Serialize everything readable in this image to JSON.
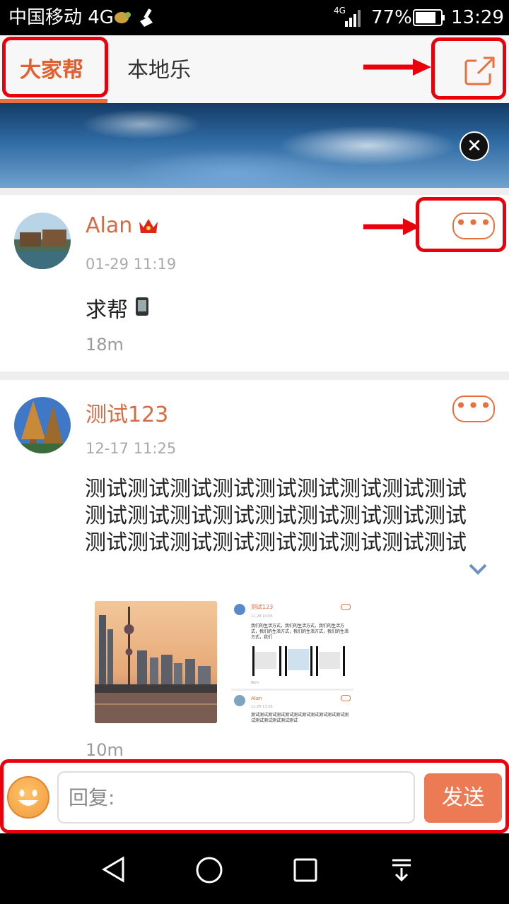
{
  "status_bar": {
    "carrier": "中国移动 4G",
    "network": "4G",
    "battery": "77%",
    "time": "13:29"
  },
  "header": {
    "tabs": [
      {
        "label": "大家帮",
        "active": true
      },
      {
        "label": "本地乐",
        "active": false
      }
    ],
    "share_icon": "share-external-icon",
    "accent_color": "#e8703f"
  },
  "banner": {
    "close_icon": "close-icon"
  },
  "posts": [
    {
      "username": "Alan",
      "badge_icon": "crown-icon",
      "timestamp": "01-29 11:19",
      "text": "求帮",
      "distance": "18m",
      "more_icon": "more-dots-icon"
    },
    {
      "username": "测试123",
      "timestamp": "12-17 11:25",
      "text_lines": [
        "测试测试测试测试测试测试测试测试测试",
        "测试测试测试测试测试测试测试测试测试",
        "测试测试测试测试测试测试测试测试测试"
      ],
      "distance": "10m",
      "more_icon": "more-dots-icon",
      "expand_icon": "chevron-down-icon",
      "thumbnail_screenshot": {
        "username1": "测试123",
        "time1": "11-28 10:06",
        "text1": "我们的生活方式，我们的生活方式，我们的生活方式，我们的生活方式，我们的生活方式，我们的生活方式，我们",
        "distance1": "0km",
        "username2": "Alan",
        "time2": "11-28 13:36",
        "text2": "测试测试测试测试测试测试测试测试测试测试测试测试测试测试测试测试测试"
      }
    }
  ],
  "reply_bar": {
    "placeholder": "回复:",
    "send_label": "发送",
    "emoji_icon": "emoji-smile-icon"
  },
  "nav_bar": {
    "icons": [
      "back-icon",
      "home-icon",
      "recents-icon",
      "notifications-pull-icon"
    ]
  }
}
